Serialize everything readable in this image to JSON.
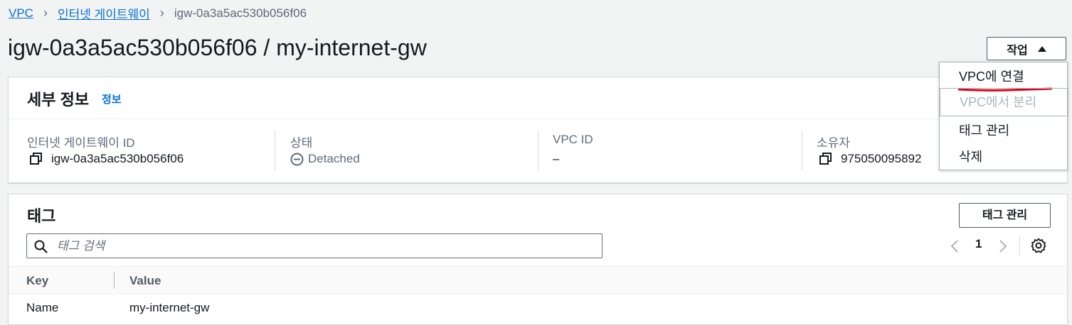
{
  "breadcrumb": {
    "items": [
      "VPC",
      "인터넷 게이트웨이"
    ],
    "current": "igw-0a3a5ac530b056f06"
  },
  "page": {
    "title": "igw-0a3a5ac530b056f06 / my-internet-gw"
  },
  "actions": {
    "label": "작업",
    "menu": [
      {
        "label": "VPC에 연결",
        "enabled": true
      },
      {
        "label": "VPC에서 분리",
        "enabled": false
      },
      {
        "label": "태그 관리",
        "enabled": true
      },
      {
        "label": "삭제",
        "enabled": true
      }
    ]
  },
  "details": {
    "title": "세부 정보",
    "info": "정보",
    "fields": [
      {
        "label": "인터넷 게이트웨이 ID",
        "value": "igw-0a3a5ac530b056f06"
      },
      {
        "label": "상태",
        "value": "Detached"
      },
      {
        "label": "VPC ID",
        "value": "–"
      },
      {
        "label": "소유자",
        "value": "975050095892"
      }
    ]
  },
  "tags": {
    "title": "태그",
    "manage_button": "태그 관리",
    "search_placeholder": "태그 검색",
    "page": "1",
    "columns": [
      "Key",
      "Value"
    ],
    "rows": [
      {
        "key": "Name",
        "value": "my-internet-gw"
      }
    ]
  },
  "colors": {
    "link": "#0972d3",
    "highlight_underline": "#e3001b"
  }
}
